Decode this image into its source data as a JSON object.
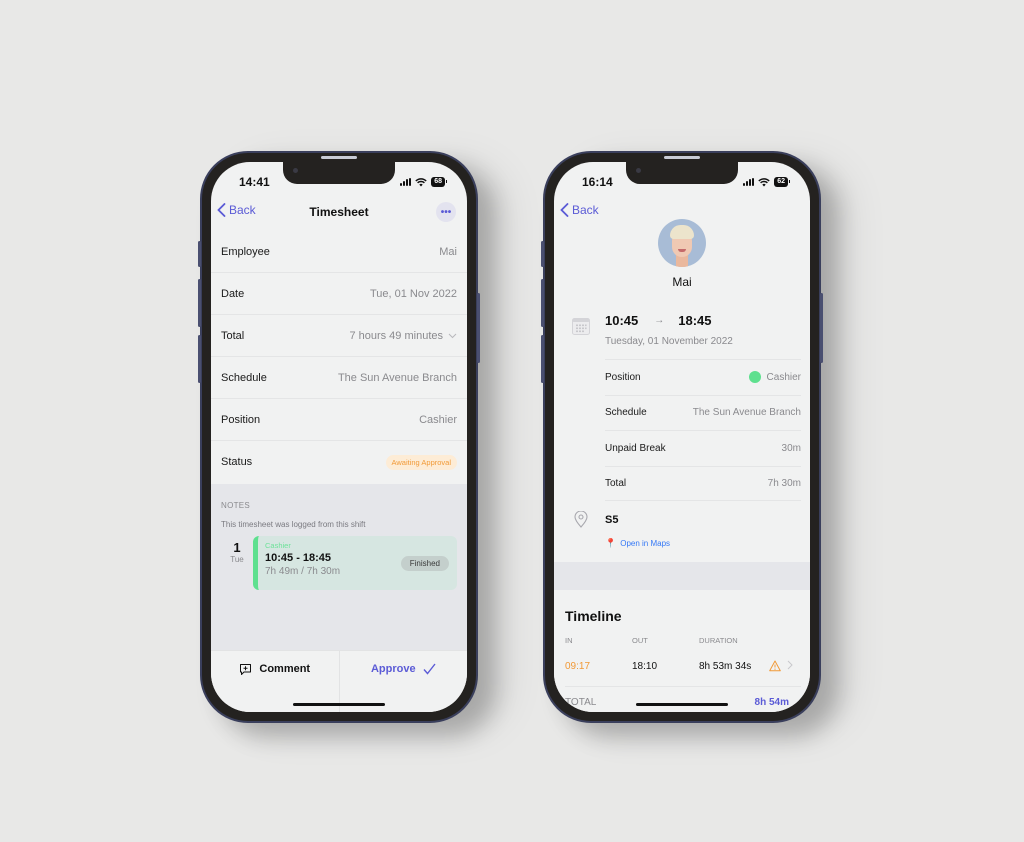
{
  "left_phone": {
    "status_bar": {
      "time": "14:41",
      "battery": "68"
    },
    "nav": {
      "back_label": "Back",
      "title": "Timesheet",
      "more_label": "•••"
    },
    "rows": [
      {
        "label": "Employee",
        "value": "Mai"
      },
      {
        "label": "Date",
        "value": "Tue, 01 Nov 2022"
      },
      {
        "label": "Total",
        "value": "7 hours 49 minutes"
      },
      {
        "label": "Schedule",
        "value": "The Sun Avenue Branch"
      },
      {
        "label": "Position",
        "value": "Cashier"
      },
      {
        "label": "Status",
        "value": "Awaiting Approval"
      }
    ],
    "notes": {
      "heading": "NOTES",
      "description": "This timesheet was logged from this shift",
      "shift": {
        "day_num": "1",
        "day_name": "Tue",
        "role": "Cashier",
        "time_range": "10:45 - 18:45",
        "duration": "7h 49m / 7h 30m",
        "state": "Finished"
      }
    },
    "bottom_bar": {
      "comment_label": "Comment",
      "approve_label": "Approve"
    },
    "colors": {
      "accent": "#5b5bd6",
      "status_awaiting": "#f19a38",
      "role_green": "#5ee08f"
    }
  },
  "right_phone": {
    "status_bar": {
      "time": "16:14",
      "battery": "62"
    },
    "nav": {
      "back_label": "Back"
    },
    "profile": {
      "name": "Mai"
    },
    "shift": {
      "start": "10:45",
      "arrow": "→",
      "end": "18:45",
      "date": "Tuesday, 01 November 2022"
    },
    "details": [
      {
        "label": "Position",
        "value": "Cashier"
      },
      {
        "label": "Schedule",
        "value": "The Sun Avenue Branch"
      },
      {
        "label": "Unpaid Break",
        "value": "30m"
      },
      {
        "label": "Total",
        "value": "7h 30m"
      }
    ],
    "location": {
      "name": "S5",
      "maps_link": "Open in Maps"
    },
    "timeline": {
      "title": "Timeline",
      "headers": {
        "in": "IN",
        "out": "OUT",
        "duration": "DURATION"
      },
      "entries": [
        {
          "in": "09:17",
          "out": "18:10",
          "duration": "8h 53m 34s"
        }
      ],
      "total_label": "TOTAL",
      "total_value": "8h 54m"
    }
  }
}
